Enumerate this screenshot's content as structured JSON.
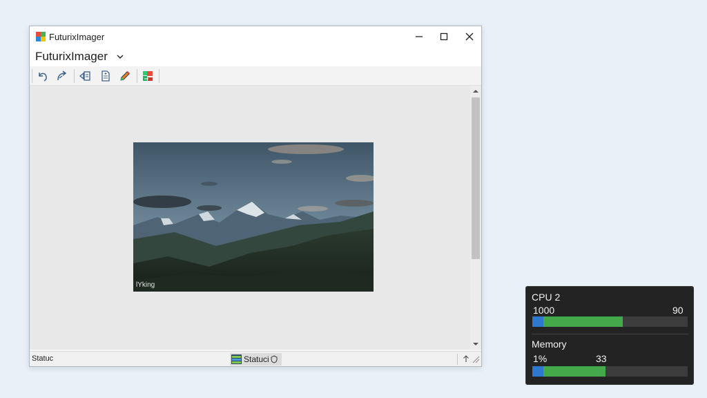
{
  "window": {
    "title": "FuturixImager",
    "menu_title": "FuturixImager"
  },
  "toolbar": {
    "buttons": [
      {
        "icon": "undo-icon"
      },
      {
        "icon": "redo-icon"
      },
      {
        "icon": "open-folder-icon"
      },
      {
        "icon": "document-icon"
      },
      {
        "icon": "pencil-icon"
      },
      {
        "icon": "flag-tool-icon"
      }
    ]
  },
  "image": {
    "caption": "lYking"
  },
  "statusbar": {
    "left_text": "Statuc",
    "middle_text": "Statuci"
  },
  "monitor": {
    "cpu": {
      "label": "CPU 2",
      "left_value": "1000",
      "right_value": "90",
      "blue_fraction": 0.07,
      "green_fraction": 0.58
    },
    "memory": {
      "label": "Memory",
      "left_value": "1%",
      "right_value": "33",
      "blue_fraction": 0.07,
      "green_fraction": 0.47
    },
    "colors": {
      "used": "#45a84a",
      "accent": "#2f78d0",
      "track": "#3c3c3c"
    }
  }
}
